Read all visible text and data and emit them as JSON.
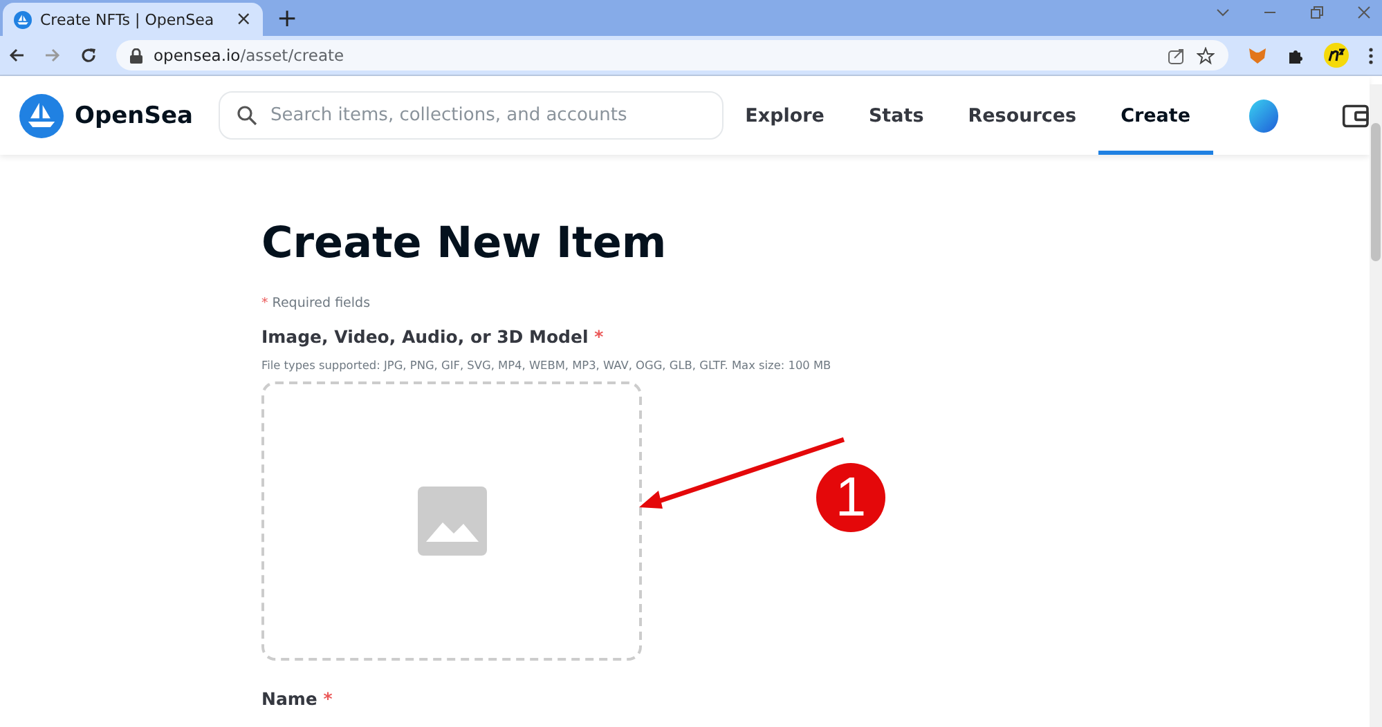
{
  "browser": {
    "tab_title": "Create NFTs | OpenSea",
    "tab_close": "×",
    "new_tab": "+",
    "url_host": "opensea.io",
    "url_path": "/asset/create"
  },
  "header": {
    "brand": "OpenSea",
    "search": {
      "placeholder": "Search items, collections, and accounts"
    },
    "nav": [
      {
        "label": "Explore",
        "selected": false
      },
      {
        "label": "Stats",
        "selected": false
      },
      {
        "label": "Resources",
        "selected": false
      },
      {
        "label": "Create",
        "selected": true
      }
    ]
  },
  "form": {
    "title": "Create New Item",
    "required_note": {
      "mark": "*",
      "text": "Required fields"
    },
    "media": {
      "label": "Image, Video, Audio, or 3D Model",
      "mark": "*",
      "hint": "File types supported: JPG, PNG, GIF, SVG, MP4, WEBM, MP3, WAV, OGG, GLB, GLTF. Max size: 100 MB"
    },
    "name": {
      "label": "Name",
      "mark": "*"
    }
  },
  "callout": {
    "number": "1"
  }
}
